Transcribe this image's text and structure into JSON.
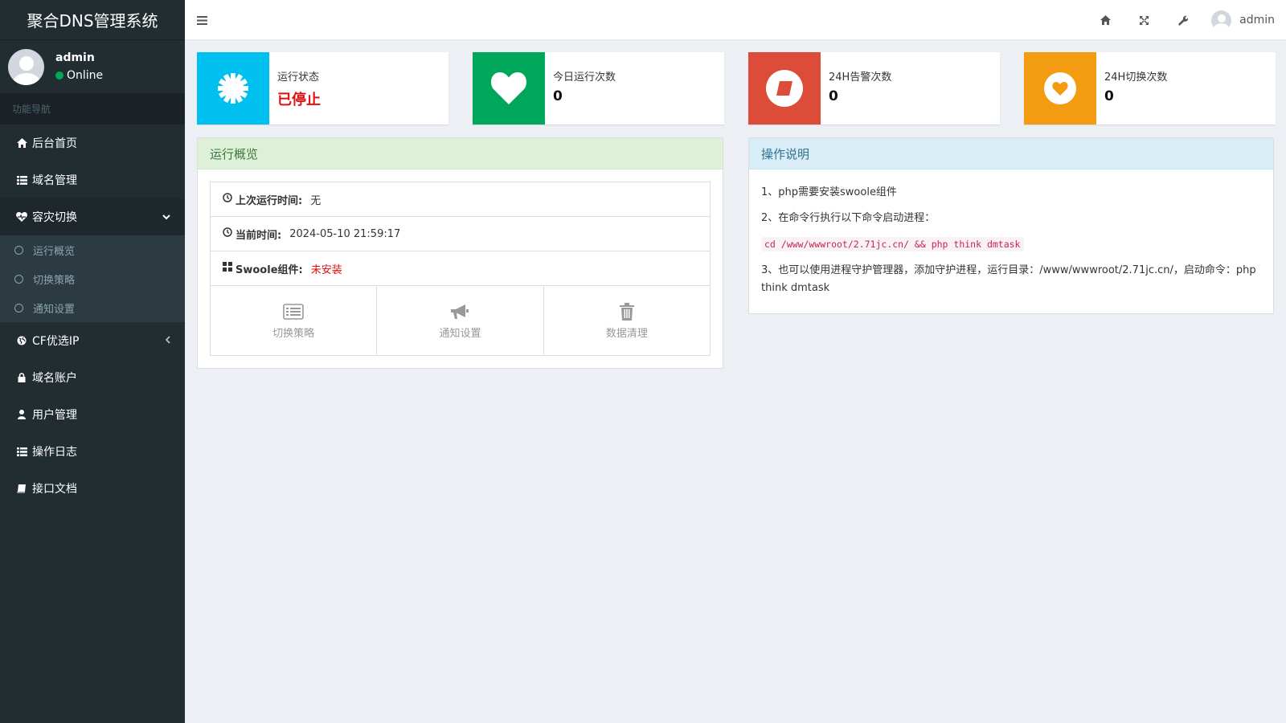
{
  "app": {
    "title": "聚合DNS管理系统"
  },
  "user": {
    "name": "admin",
    "status": "Online"
  },
  "sidebar": {
    "header": "功能导航",
    "items": [
      {
        "label": "后台首页",
        "icon": "home-icon"
      },
      {
        "label": "域名管理",
        "icon": "list-icon"
      },
      {
        "label": "容灾切换",
        "icon": "heartbeat-icon",
        "expanded": true,
        "children": [
          {
            "label": "运行概览"
          },
          {
            "label": "切换策略"
          },
          {
            "label": "通知设置"
          }
        ]
      },
      {
        "label": "CF优选IP",
        "icon": "globe-icon"
      },
      {
        "label": "域名账户",
        "icon": "lock-icon"
      },
      {
        "label": "用户管理",
        "icon": "user-icon"
      },
      {
        "label": "操作日志",
        "icon": "list-icon"
      },
      {
        "label": "接口文档",
        "icon": "book-icon"
      }
    ]
  },
  "header": {
    "user_name": "admin"
  },
  "stats": [
    {
      "label": "运行状态",
      "value": "已停止",
      "color": "#00c0ef",
      "icon": "gear-icon"
    },
    {
      "label": "今日运行次数",
      "value": "0",
      "color": "#00a65a",
      "icon": "heart-icon"
    },
    {
      "label": "24H告警次数",
      "value": "0",
      "color": "#dd4b39",
      "icon": "eraser-icon"
    },
    {
      "label": "24H切换次数",
      "value": "0",
      "color": "#f39c12",
      "icon": "heart-circle-icon"
    }
  ],
  "overview": {
    "title": "运行概览",
    "last_run_label": "上次运行时间:",
    "last_run_value": "无",
    "current_time_label": "当前时间:",
    "current_time_value": "2024-05-10 21:59:17",
    "swoole_label": "Swoole组件:",
    "swoole_value": "未安装",
    "buttons": [
      {
        "label": "切换策略",
        "icon": "list-alt-icon"
      },
      {
        "label": "通知设置",
        "icon": "bullhorn-icon"
      },
      {
        "label": "数据清理",
        "icon": "trash-icon"
      }
    ]
  },
  "instructions": {
    "title": "操作说明",
    "line1": "1、php需要安装swoole组件",
    "line2": "2、在命令行执行以下命令启动进程：",
    "command": "cd /www/wwwroot/2.71jc.cn/ && php think dmtask",
    "line3": "3、也可以使用进程守护管理器，添加守护进程，运行目录：/www/wwwroot/2.71jc.cn/，启动命令：php think dmtask"
  }
}
